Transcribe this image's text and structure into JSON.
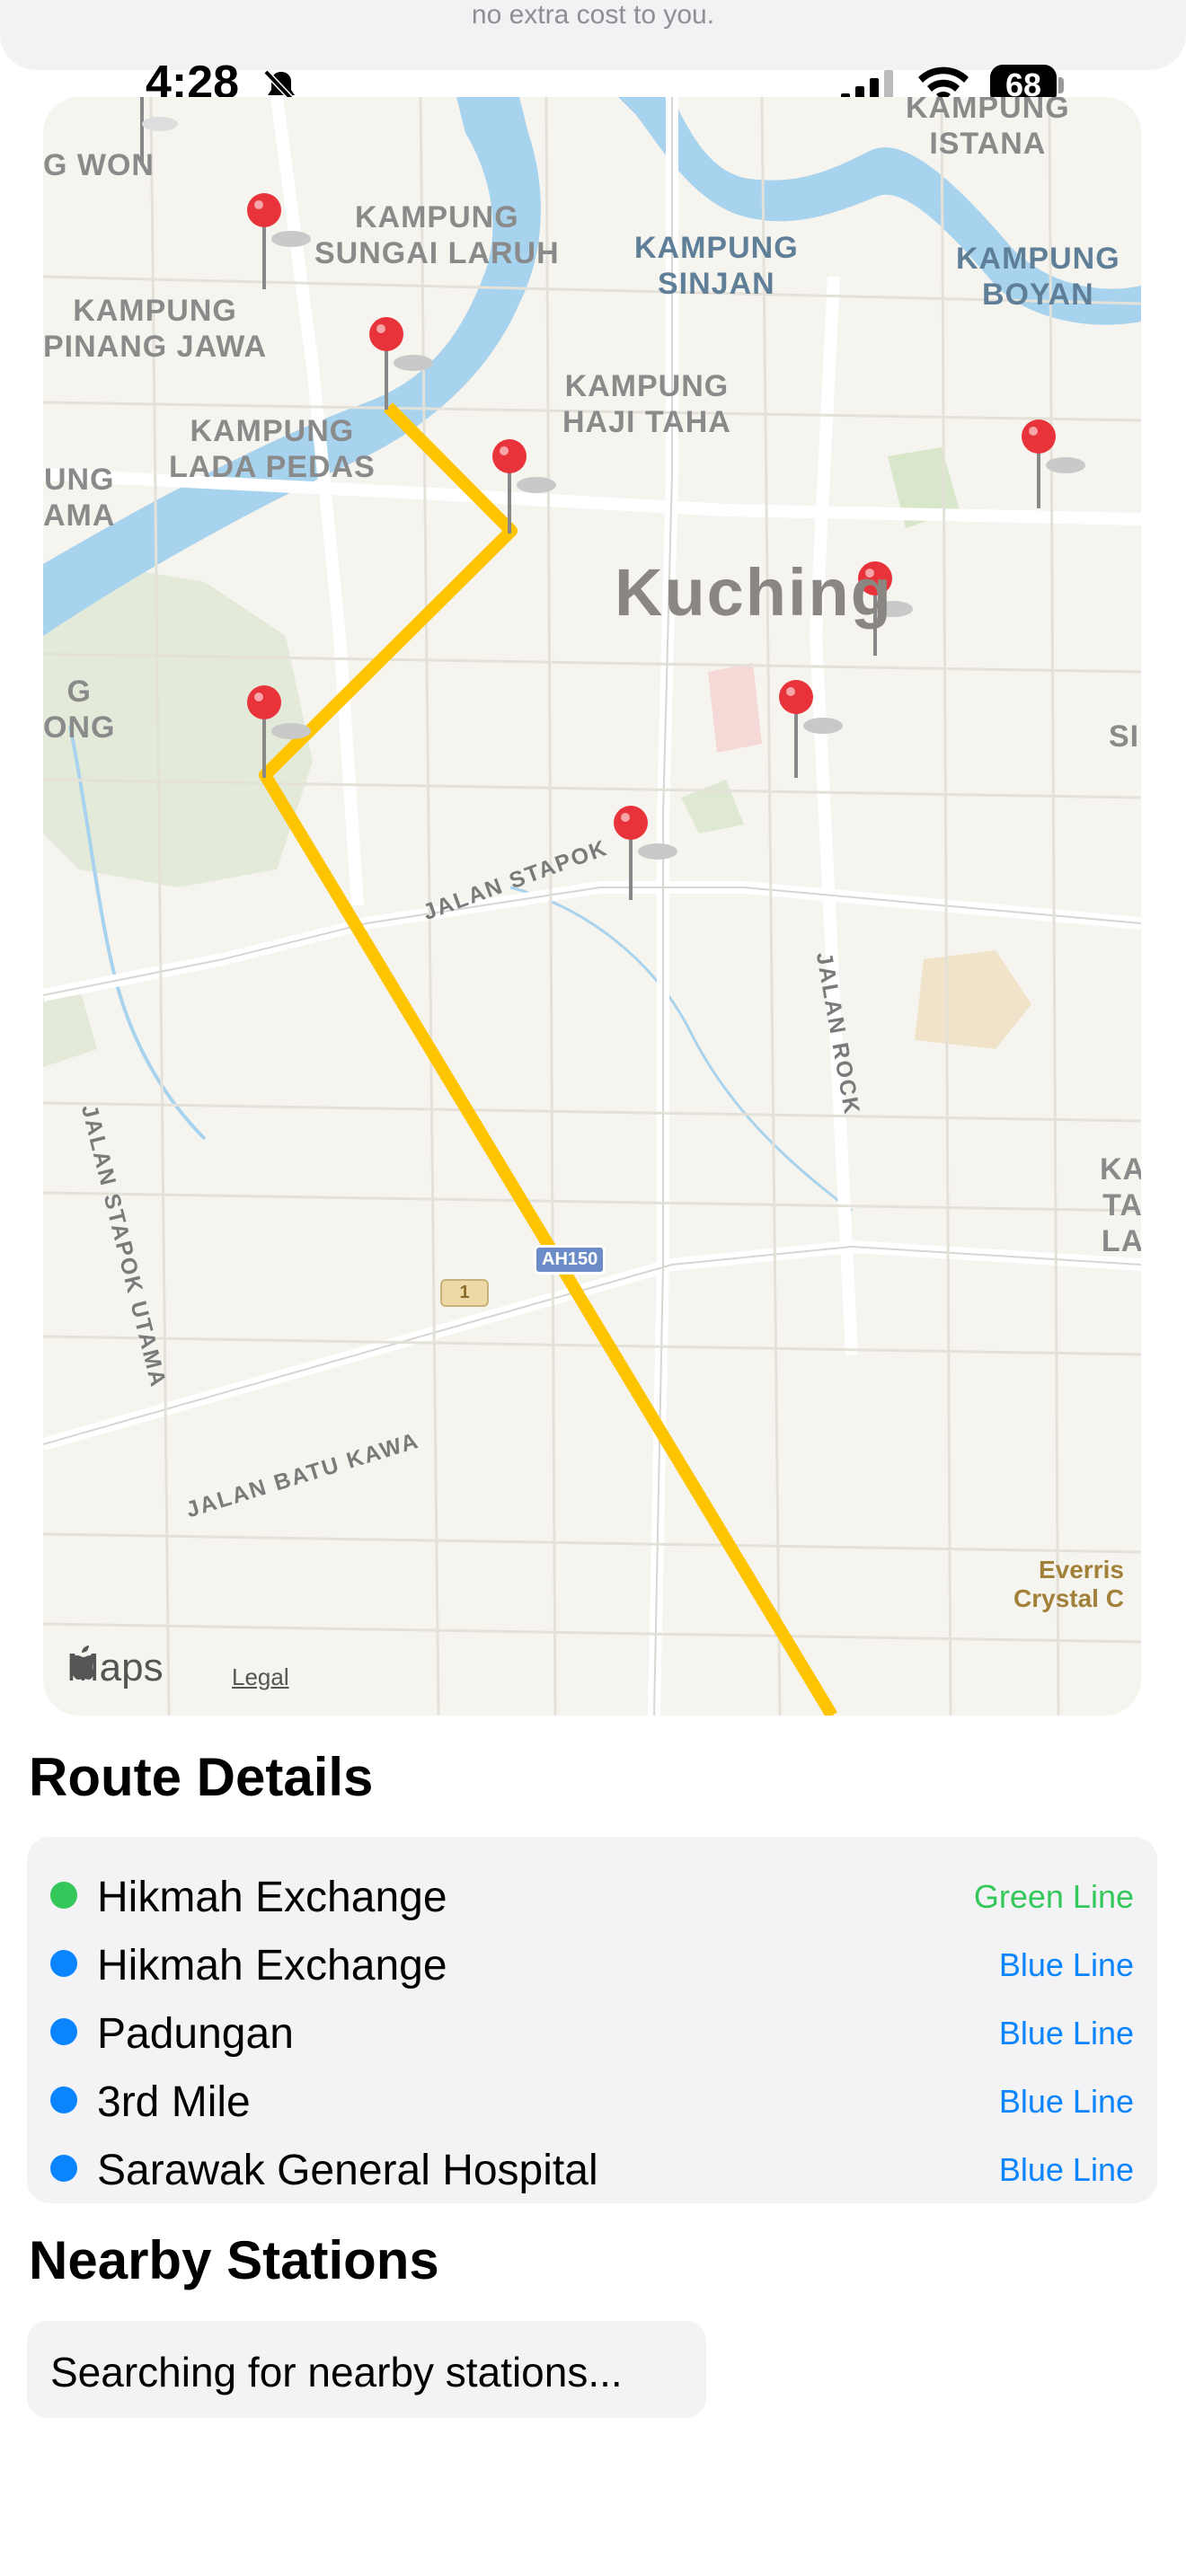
{
  "banner": {
    "text": "no extra cost to you."
  },
  "status_bar": {
    "time": "4:28",
    "battery": "68",
    "icons": [
      "bell-slash-icon",
      "signal-icon",
      "wifi-icon",
      "battery-icon"
    ]
  },
  "map": {
    "areas": [
      {
        "key": "a1",
        "text": "G WON"
      },
      {
        "key": "a2",
        "text": "KAMPUNG\nSUNGAI LARUH"
      },
      {
        "key": "a3",
        "text": "KAMPUNG\nSINJAN"
      },
      {
        "key": "a4",
        "text": "KAMPUNG\nISTANA"
      },
      {
        "key": "a5",
        "text": "KAMPUNG\nBOYAN"
      },
      {
        "key": "a6",
        "text": "KAMPUNG\nPINANG JAWA"
      },
      {
        "key": "a7",
        "text": "KAMPUNG\nHAJI TAHA"
      },
      {
        "key": "a8",
        "text": "KAMPUNG\nLADA PEDAS"
      },
      {
        "key": "a9",
        "text": "UNG\nAMA"
      },
      {
        "key": "a10",
        "text": "G\nONG"
      },
      {
        "key": "a11",
        "text": "SI"
      },
      {
        "key": "a12",
        "text": "KA\nTA\nLA"
      }
    ],
    "city": "Kuching",
    "roads": [
      "JALAN STAPOK",
      "JALAN ROCK",
      "JALAN STAPOK UTAMA",
      "JALAN BATU KAWA"
    ],
    "badges": [
      "AH150",
      "1"
    ],
    "poi": "Everris\nCrystal C",
    "attribution": {
      "brand": "Maps",
      "legal": "Legal"
    },
    "route_color": "#FFC400",
    "pin_color": "#E8333A"
  },
  "route_details": {
    "title": "Route Details",
    "stops": [
      {
        "name": "Hikmah Exchange",
        "line": "Green Line",
        "color": "#34C759"
      },
      {
        "name": "Hikmah Exchange",
        "line": "Blue Line",
        "color": "#0A84FF"
      },
      {
        "name": "Padungan",
        "line": "Blue Line",
        "color": "#0A84FF"
      },
      {
        "name": "3rd Mile",
        "line": "Blue Line",
        "color": "#0A84FF"
      },
      {
        "name": "Sarawak General Hospital",
        "line": "Blue Line",
        "color": "#0A84FF"
      }
    ]
  },
  "nearby": {
    "title": "Nearby Stations",
    "status": "Searching for nearby stations..."
  }
}
